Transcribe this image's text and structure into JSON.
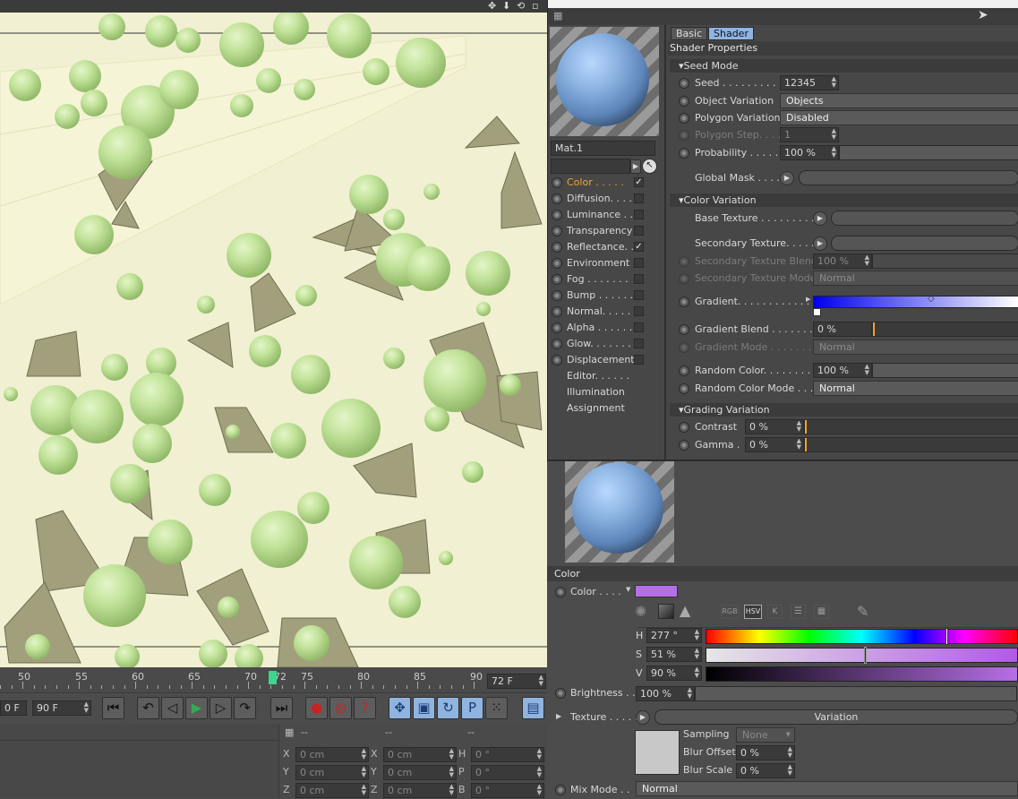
{
  "timeline": {
    "ticks": [
      "50",
      "55",
      "60",
      "65",
      "70",
      "72",
      "75",
      "80",
      "85",
      "90"
    ],
    "current_frame": "72 F"
  },
  "transport": {
    "start_field": "0 F",
    "end_field": "90 F"
  },
  "coords": {
    "header": [
      "--",
      "--",
      "--"
    ],
    "rows": [
      {
        "a": "X",
        "av": "0 cm",
        "b": "X",
        "bv": "0 cm",
        "c": "H",
        "cv": "0 °"
      },
      {
        "a": "Y",
        "av": "0 cm",
        "b": "Y",
        "bv": "0 cm",
        "c": "P",
        "cv": "0 °"
      },
      {
        "a": "Z",
        "av": "0 cm",
        "b": "Z",
        "bv": "0 cm",
        "c": "B",
        "cv": "0 °"
      }
    ]
  },
  "material": {
    "name": "Mat.1",
    "tabs": [
      "Basic",
      "Shader"
    ],
    "section_title": "Shader Properties",
    "channels": [
      {
        "label": "Color . . . . .",
        "checked": "✓",
        "active": true
      },
      {
        "label": "Diffusion. . . .",
        "checked": ""
      },
      {
        "label": "Luminance . .",
        "checked": ""
      },
      {
        "label": "Transparency",
        "checked": ""
      },
      {
        "label": "Reflectance. .",
        "checked": "✓"
      },
      {
        "label": "Environment",
        "checked": ""
      },
      {
        "label": "Fog . . . . . . .",
        "checked": ""
      },
      {
        "label": "Bump . . . . . .",
        "checked": ""
      },
      {
        "label": "Normal. . . . .",
        "checked": ""
      },
      {
        "label": "Alpha . . . . . .",
        "checked": ""
      },
      {
        "label": "Glow. . . . . . .",
        "checked": ""
      },
      {
        "label": "Displacement",
        "checked": ""
      }
    ],
    "extra_items": [
      "Editor. . . . . .",
      "Illumination",
      "Assignment"
    ]
  },
  "shader": {
    "seed_mode": {
      "title": "Seed Mode",
      "seed_label": "Seed . . . . . . . . . . .",
      "seed_value": "12345",
      "object_variation_label": "Object Variation",
      "object_variation_value": "Objects",
      "polygon_variation_label": "Polygon Variation",
      "polygon_variation_value": "Disabled",
      "polygon_step_label": "Polygon Step. . . .",
      "polygon_step_value": "1",
      "probability_label": "Probability . . . . .",
      "probability_value": "100 %",
      "probability_fraction": 1.0,
      "global_mask_label": "Global Mask . . . . ."
    },
    "color_variation": {
      "title": "Color Variation",
      "base_texture_label": "Base Texture . . . . . . . . . .",
      "secondary_texture_label": "Secondary Texture. . . . . .",
      "secondary_blend_label": "Secondary Texture Blend",
      "secondary_blend_value": "100 %",
      "secondary_mode_label": "Secondary Texture Mode",
      "secondary_mode_value": "Normal",
      "gradient_label": "Gradient. . . . . . . . . . . . .",
      "gradient_blend_label": "Gradient Blend . . . . . . . .",
      "gradient_blend_value": "0 %",
      "gradient_mode_label": "Gradient Mode . . . . . . . .",
      "gradient_mode_value": "Normal",
      "random_color_label": "Random Color. . . . . . . . .",
      "random_color_value": "100 %",
      "random_color_mode_label": "Random Color Mode . . . .",
      "random_color_mode_value": "Normal"
    },
    "grading_variation": {
      "title": "Grading Variation",
      "contrast_label": "Contrast",
      "contrast_value": "0 %",
      "gamma_label": "Gamma .",
      "gamma_value": "0 %"
    }
  },
  "attributes": {
    "section_title": "Color",
    "color_label": "Color . . . .",
    "color_swatch": "#b56fe6",
    "mode_buttons": [
      "RGB",
      "HSV",
      "K"
    ],
    "h_label": "H",
    "h_value": "277 °",
    "h_fraction": 0.77,
    "s_label": "S",
    "s_value": "51 %",
    "s_fraction": 0.51,
    "v_label": "V",
    "v_value": "90 %",
    "v_fraction": 0.9,
    "brightness_label": "Brightness . .",
    "brightness_value": "100 %",
    "texture_label": "Texture . . . . .",
    "texture_value": "Variation",
    "sampling_label": "Sampling",
    "sampling_value": "None",
    "blur_offset_label": "Blur Offset",
    "blur_offset_value": "0 %",
    "blur_scale_label": "Blur Scale",
    "blur_scale_value": "0 %",
    "mix_mode_label": "Mix Mode . .",
    "mix_mode_value": "Normal"
  }
}
